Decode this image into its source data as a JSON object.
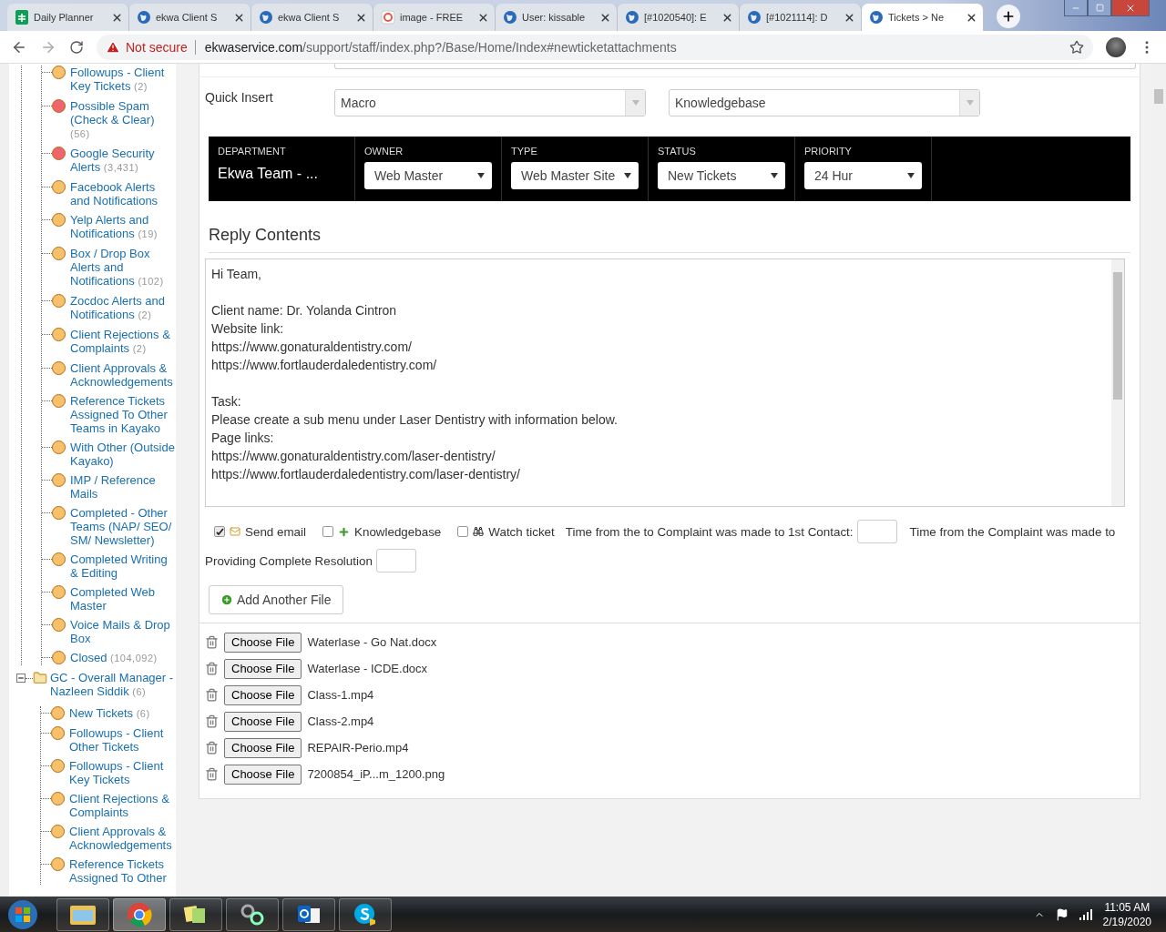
{
  "browser": {
    "tabs": [
      {
        "title": "Daily Planner",
        "kind": "sheet",
        "selected": false
      },
      {
        "title": "ekwa Client S",
        "kind": "globe",
        "selected": false
      },
      {
        "title": "ekwa Client S",
        "kind": "globe",
        "selected": false
      },
      {
        "title": "image - FREE",
        "kind": "image",
        "selected": false
      },
      {
        "title": "User: kissable",
        "kind": "globe",
        "selected": false
      },
      {
        "title": "[#1020540]: E",
        "kind": "globe",
        "selected": false
      },
      {
        "title": "[#1021114]: D",
        "kind": "globe",
        "selected": false
      },
      {
        "title": "Tickets > Ne",
        "kind": "globe",
        "selected": true
      }
    ],
    "address": {
      "warning": "Not secure",
      "host": "ekwaservice.com",
      "path": "/support/staff/index.php?/Base/Home/Index#newticketattachments"
    }
  },
  "sidebar": {
    "items": [
      {
        "label": "Followups - Client Key Tickets",
        "count": "(2)",
        "color": "#f7c16b"
      },
      {
        "label": "Possible Spam (Check & Clear)",
        "count": "(56)",
        "color": "#f0646e"
      },
      {
        "label": "Google Security Alerts",
        "count": "(3,431)",
        "color": "#f0646e"
      },
      {
        "label": "Facebook Alerts and Notifications",
        "color": "#f7c16b"
      },
      {
        "label": "Yelp Alerts and Notifications",
        "count": "(19)",
        "color": "#f7c16b"
      },
      {
        "label": "Box / Drop Box Alerts and Notifications",
        "count": "(102)",
        "color": "#f7c16b"
      },
      {
        "label": "Zocdoc Alerts and Notifications",
        "count": "(2)",
        "color": "#f7c16b"
      },
      {
        "label": "Client Rejections & Complaints",
        "count": "(2)",
        "color": "#f7c16b"
      },
      {
        "label": "Client Approvals & Acknowledgements",
        "color": "#f7c16b"
      },
      {
        "label": "Reference Tickets Assigned To Other Teams in Kayako",
        "color": "#f7c16b"
      },
      {
        "label": "With Other (Outside Kayako)",
        "color": "#f7c16b"
      },
      {
        "label": "IMP / Reference Mails",
        "color": "#f7c16b"
      },
      {
        "label": "Completed - Other Teams (NAP/ SEO/ SM/ Newsletter)",
        "color": "#f7c16b"
      },
      {
        "label": "Completed Writing & Editing",
        "color": "#f7c16b"
      },
      {
        "label": "Completed Web Master",
        "color": "#f7c16b"
      },
      {
        "label": "Voice Mails & Drop Box",
        "color": "#f7c16b"
      },
      {
        "label": "Closed",
        "count": "(104,092)",
        "color": "#f7c16b"
      }
    ],
    "groups": [
      {
        "label": "GC - Overall Manager - Nazleen Siddik",
        "count": "(6)",
        "expanded": true,
        "children": [
          {
            "label": "New Tickets",
            "count": "(6)",
            "color": "#f7c16b"
          },
          {
            "label": "Followups - Client Other Tickets",
            "color": "#f7c16b"
          },
          {
            "label": "Followups - Client Key Tickets",
            "color": "#f7c16b"
          },
          {
            "label": "Client Rejections & Complaints",
            "color": "#f7c16b"
          },
          {
            "label": "Client Approvals & Acknowledgements",
            "color": "#f7c16b"
          },
          {
            "label": "Reference Tickets Assigned To Other",
            "color": "#f7c16b"
          }
        ]
      }
    ]
  },
  "quick_insert": {
    "label": "Quick Insert",
    "selects": [
      "Macro",
      "Knowledgebase"
    ]
  },
  "ticket_properties": [
    {
      "label": "DEPARTMENT",
      "kind": "text",
      "value": "Ekwa Team - ..."
    },
    {
      "label": "OWNER",
      "kind": "select",
      "value": "Web Master"
    },
    {
      "label": "TYPE",
      "kind": "select",
      "value": "Web Master Site"
    },
    {
      "label": "STATUS",
      "kind": "select",
      "value": "New Tickets"
    },
    {
      "label": "PRIORITY",
      "kind": "select",
      "value": "24 Hur"
    }
  ],
  "reply": {
    "title": "Reply Contents",
    "paragraphs": [
      [
        "Hi Team,"
      ],
      [
        "Client name: Dr. Yolanda Cintron",
        "Website link:",
        "https://www.gonaturaldentistry.com/",
        "https://www.fortlauderdaledentistry.com/"
      ],
      [
        "Task:",
        "Please create a sub menu under Laser Dentistry with information below.",
        "Page links:",
        "https://www.gonaturaldentistry.com/laser-dentistry/",
        "https://www.fortlauderdaledentistry.com/laser-dentistry/"
      ]
    ]
  },
  "options": [
    {
      "label": "Send email",
      "kind": "mail",
      "checked": true
    },
    {
      "label": "Knowledgebase",
      "kind": "plus",
      "checked": false
    },
    {
      "label": "Watch ticket",
      "kind": "binoculars",
      "checked": false
    }
  ],
  "timings": [
    {
      "lines": [
        "Time from the to Complaint was made to 1st Contact:"
      ]
    },
    {
      "lines": [
        "Time from the Complaint was made to",
        "Providing Complete Resolution"
      ]
    }
  ],
  "add_file_button": "Add Another File",
  "attachments": [
    {
      "button": "Choose File",
      "file": "Waterlase - Go Nat.docx"
    },
    {
      "button": "Choose File",
      "file": "Waterlase - ICDE.docx"
    },
    {
      "button": "Choose File",
      "file": "Class-1.mp4"
    },
    {
      "button": "Choose File",
      "file": "Class-2.mp4"
    },
    {
      "button": "Choose File",
      "file": "REPAIR-Perio.mp4"
    },
    {
      "button": "Choose File",
      "file": "7200854_iP...m_1200.png"
    }
  ],
  "taskbar": {
    "apps": [
      {
        "kind": "explorer",
        "active": false
      },
      {
        "kind": "chrome",
        "active": true
      },
      {
        "kind": "notes",
        "active": false
      },
      {
        "kind": "network",
        "active": false
      },
      {
        "kind": "outlook",
        "active": false
      },
      {
        "kind": "skype",
        "active": false
      }
    ],
    "time": "11:05 AM",
    "date": "2/19/2020"
  }
}
